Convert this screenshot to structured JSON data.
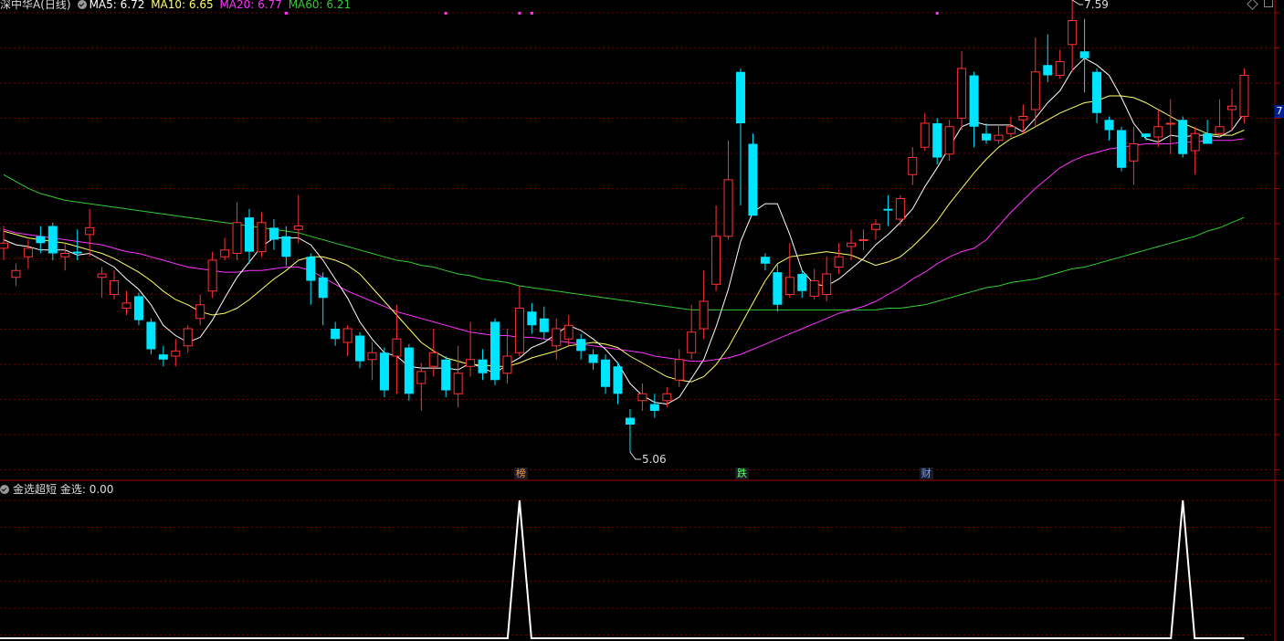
{
  "header": {
    "title": "深中华A(日线)",
    "ma5_label": "MA5: 6.72",
    "ma10_label": "MA10: 6.65",
    "ma20_label": "MA20: 6.77",
    "ma60_label": "MA60: 6.21"
  },
  "indicator": {
    "name": "金选超短",
    "value_label": "金选: 0.00"
  },
  "right_axis_label": "7",
  "events": [
    {
      "label": "榜",
      "bar": 42,
      "color": "#ff9933"
    },
    {
      "label": "跌",
      "bar": 60,
      "color": "#66ff66"
    },
    {
      "label": "财",
      "bar": 75,
      "color": "#66aaff"
    }
  ],
  "colors": {
    "up": "#ff3333",
    "down": "#00e5ff",
    "ma5": "#ffffff",
    "ma10": "#ffff66",
    "ma20": "#ff33ff",
    "ma60": "#33cc33",
    "grid": "#7a0000",
    "divider": "#a00000"
  },
  "chart_data": {
    "type": "candlestick",
    "y_range": [
      4.9,
      7.7
    ],
    "high_annotation": "7.59",
    "low_annotation": "5.06",
    "candles": [
      [
        6.25,
        6.28,
        6.38,
        6.18
      ],
      [
        6.08,
        6.12,
        6.16,
        6.03
      ],
      [
        6.2,
        6.25,
        6.3,
        6.13
      ],
      [
        6.32,
        6.28,
        6.38,
        6.22
      ],
      [
        6.38,
        6.22,
        6.4,
        6.18
      ],
      [
        6.2,
        6.22,
        6.28,
        6.12
      ],
      [
        6.23,
        6.22,
        6.36,
        6.18
      ],
      [
        6.33,
        6.37,
        6.48,
        6.2
      ],
      [
        6.08,
        6.1,
        6.14,
        5.96
      ],
      [
        5.98,
        6.06,
        6.12,
        5.95
      ],
      [
        5.9,
        5.93,
        6.0,
        5.86
      ],
      [
        5.97,
        5.83,
        5.99,
        5.8
      ],
      [
        5.82,
        5.66,
        5.84,
        5.63
      ],
      [
        5.63,
        5.6,
        5.68,
        5.56
      ],
      [
        5.62,
        5.65,
        5.72,
        5.56
      ],
      [
        5.68,
        5.78,
        5.8,
        5.64
      ],
      [
        5.84,
        5.92,
        5.98,
        5.8
      ],
      [
        6.0,
        6.18,
        6.23,
        5.96
      ],
      [
        6.2,
        6.24,
        6.31,
        6.18
      ],
      [
        6.22,
        6.4,
        6.52,
        6.18
      ],
      [
        6.43,
        6.23,
        6.48,
        6.16
      ],
      [
        6.23,
        6.4,
        6.46,
        6.2
      ],
      [
        6.37,
        6.3,
        6.42,
        6.24
      ],
      [
        6.32,
        6.2,
        6.38,
        6.15
      ],
      [
        6.36,
        6.38,
        6.56,
        6.28
      ],
      [
        6.2,
        6.06,
        6.22,
        5.92
      ],
      [
        6.08,
        5.96,
        6.11,
        5.8
      ],
      [
        5.78,
        5.72,
        5.82,
        5.68
      ],
      [
        5.7,
        5.78,
        5.8,
        5.62
      ],
      [
        5.74,
        5.59,
        5.76,
        5.55
      ],
      [
        5.6,
        5.64,
        5.7,
        5.48
      ],
      [
        5.64,
        5.42,
        5.67,
        5.38
      ],
      [
        5.62,
        5.72,
        5.92,
        5.4
      ],
      [
        5.67,
        5.4,
        5.69,
        5.36
      ],
      [
        5.46,
        5.53,
        5.58,
        5.3
      ],
      [
        5.56,
        5.64,
        5.78,
        5.5
      ],
      [
        5.6,
        5.42,
        5.62,
        5.38
      ],
      [
        5.4,
        5.52,
        5.68,
        5.32
      ],
      [
        5.56,
        5.6,
        5.82,
        5.5
      ],
      [
        5.6,
        5.52,
        5.66,
        5.48
      ],
      [
        5.82,
        5.48,
        5.84,
        5.45
      ],
      [
        5.52,
        5.62,
        5.78,
        5.46
      ],
      [
        5.64,
        5.9,
        6.03,
        5.62
      ],
      [
        5.88,
        5.8,
        5.93,
        5.75
      ],
      [
        5.84,
        5.76,
        5.91,
        5.72
      ],
      [
        5.68,
        5.78,
        5.84,
        5.6
      ],
      [
        5.72,
        5.8,
        5.86,
        5.68
      ],
      [
        5.72,
        5.65,
        5.75,
        5.6
      ],
      [
        5.63,
        5.58,
        5.66,
        5.54
      ],
      [
        5.6,
        5.44,
        5.63,
        5.4
      ],
      [
        5.56,
        5.4,
        5.58,
        5.34
      ],
      [
        5.26,
        5.22,
        5.31,
        5.06
      ],
      [
        5.36,
        5.4,
        5.46,
        5.3
      ],
      [
        5.34,
        5.3,
        5.4,
        5.26
      ],
      [
        5.36,
        5.4,
        5.44,
        5.32
      ],
      [
        5.48,
        5.6,
        5.66,
        5.44
      ],
      [
        5.64,
        5.76,
        5.92,
        5.6
      ],
      [
        5.78,
        5.94,
        6.12,
        5.72
      ],
      [
        6.04,
        6.32,
        6.5,
        6.0
      ],
      [
        6.32,
        6.65,
        6.88,
        6.3
      ],
      [
        7.28,
        6.98,
        7.3,
        6.5
      ],
      [
        6.86,
        6.44,
        6.92,
        6.44
      ],
      [
        6.2,
        6.16,
        6.22,
        6.12
      ],
      [
        6.11,
        5.92,
        6.16,
        5.88
      ],
      [
        5.98,
        6.08,
        6.28,
        5.96
      ],
      [
        6.1,
        6.0,
        6.12,
        5.96
      ],
      [
        5.97,
        6.06,
        6.13,
        5.95
      ],
      [
        5.98,
        6.1,
        6.2,
        5.94
      ],
      [
        6.14,
        6.2,
        6.28,
        6.1
      ],
      [
        6.26,
        6.28,
        6.36,
        6.18
      ],
      [
        6.3,
        6.3,
        6.36,
        6.24
      ],
      [
        6.36,
        6.39,
        6.42,
        6.3
      ],
      [
        6.48,
        6.47,
        6.56,
        6.38
      ],
      [
        6.42,
        6.54,
        6.56,
        6.38
      ],
      [
        6.68,
        6.78,
        6.84,
        6.62
      ],
      [
        6.84,
        6.98,
        7.04,
        6.82
      ],
      [
        6.98,
        6.78,
        7.01,
        6.74
      ],
      [
        6.8,
        6.96,
        7.0,
        6.76
      ],
      [
        7.01,
        7.3,
        7.4,
        6.94
      ],
      [
        7.26,
        6.96,
        7.28,
        6.84
      ],
      [
        6.92,
        6.88,
        6.98,
        6.86
      ],
      [
        6.88,
        6.91,
        6.97,
        6.86
      ],
      [
        6.92,
        6.96,
        7.02,
        6.9
      ],
      [
        7.0,
        7.02,
        7.09,
        6.92
      ],
      [
        7.06,
        7.28,
        7.48,
        6.96
      ],
      [
        7.32,
        7.26,
        7.5,
        7.22
      ],
      [
        7.26,
        7.34,
        7.41,
        7.24
      ],
      [
        7.44,
        7.58,
        7.7,
        7.28
      ],
      [
        7.4,
        7.36,
        7.59,
        7.16
      ],
      [
        7.28,
        7.04,
        7.3,
        6.98
      ],
      [
        7.0,
        6.94,
        7.02,
        6.88
      ],
      [
        6.94,
        6.72,
        6.96,
        6.7
      ],
      [
        6.76,
        6.86,
        6.96,
        6.62
      ],
      [
        6.92,
        6.9,
        6.92,
        6.88
      ],
      [
        6.9,
        6.96,
        7.06,
        6.84
      ],
      [
        6.98,
        6.98,
        7.12,
        6.8
      ],
      [
        7.0,
        6.8,
        7.02,
        6.78
      ],
      [
        6.82,
        6.92,
        6.96,
        6.68
      ],
      [
        6.92,
        6.86,
        7.0,
        6.86
      ],
      [
        6.92,
        6.96,
        7.12,
        6.9
      ],
      [
        7.06,
        7.08,
        7.18,
        6.94
      ],
      [
        7.02,
        7.26,
        7.3,
        6.98
      ]
    ],
    "ma5": [
      6.3,
      6.27,
      6.26,
      6.24,
      6.24,
      6.24,
      6.21,
      6.22,
      6.18,
      6.14,
      6.07,
      6.01,
      5.92,
      5.8,
      5.74,
      5.7,
      5.73,
      5.83,
      5.96,
      6.08,
      6.17,
      6.26,
      6.31,
      6.31,
      6.31,
      6.27,
      6.18,
      6.07,
      5.96,
      5.82,
      5.72,
      5.64,
      5.62,
      5.56,
      5.55,
      5.55,
      5.55,
      5.54,
      5.58,
      5.55,
      5.52,
      5.57,
      5.61,
      5.67,
      5.7,
      5.75,
      5.8,
      5.77,
      5.72,
      5.66,
      5.58,
      5.46,
      5.39,
      5.35,
      5.34,
      5.38,
      5.49,
      5.6,
      5.79,
      6.01,
      6.29,
      6.46,
      6.51,
      6.51,
      6.33,
      6.12,
      6.04,
      6.03,
      6.07,
      6.13,
      6.19,
      6.27,
      6.33,
      6.4,
      6.48,
      6.61,
      6.72,
      6.84,
      6.96,
      6.99,
      6.97,
      6.97,
      6.97,
      6.93,
      7.01,
      7.1,
      7.17,
      7.29,
      7.36,
      7.32,
      7.26,
      7.13,
      6.98,
      6.89,
      6.87,
      6.91,
      6.9,
      6.91,
      6.91,
      6.9,
      6.94,
      7.04
    ],
    "ma10": [
      6.35,
      6.33,
      6.31,
      6.3,
      6.29,
      6.28,
      6.26,
      6.24,
      6.22,
      6.19,
      6.15,
      6.11,
      6.06,
      6.0,
      5.95,
      5.92,
      5.88,
      5.86,
      5.87,
      5.9,
      5.95,
      6.01,
      6.07,
      6.12,
      6.18,
      6.2,
      6.2,
      6.18,
      6.15,
      6.1,
      6.02,
      5.94,
      5.86,
      5.78,
      5.7,
      5.65,
      5.61,
      5.59,
      5.57,
      5.57,
      5.56,
      5.56,
      5.58,
      5.61,
      5.63,
      5.65,
      5.68,
      5.69,
      5.7,
      5.69,
      5.67,
      5.62,
      5.58,
      5.54,
      5.5,
      5.48,
      5.47,
      5.5,
      5.57,
      5.67,
      5.8,
      5.93,
      6.06,
      6.16,
      6.2,
      6.21,
      6.22,
      6.23,
      6.22,
      6.21,
      6.18,
      6.15,
      6.17,
      6.2,
      6.26,
      6.33,
      6.41,
      6.51,
      6.6,
      6.69,
      6.77,
      6.84,
      6.89,
      6.92,
      6.96,
      7.0,
      7.04,
      7.07,
      7.1,
      7.11,
      7.14,
      7.14,
      7.13,
      7.1,
      7.06,
      7.02,
      6.98,
      6.95,
      6.92,
      6.91,
      6.91,
      6.94
    ],
    "ma20": [
      6.36,
      6.34,
      6.33,
      6.32,
      6.31,
      6.3,
      6.29,
      6.28,
      6.27,
      6.25,
      6.23,
      6.22,
      6.2,
      6.18,
      6.16,
      6.14,
      6.13,
      6.12,
      6.11,
      6.11,
      6.12,
      6.12,
      6.13,
      6.14,
      6.14,
      6.12,
      6.08,
      6.04,
      6.0,
      5.97,
      5.94,
      5.91,
      5.88,
      5.86,
      5.84,
      5.82,
      5.8,
      5.78,
      5.76,
      5.75,
      5.74,
      5.74,
      5.73,
      5.73,
      5.72,
      5.71,
      5.7,
      5.69,
      5.68,
      5.67,
      5.66,
      5.65,
      5.64,
      5.62,
      5.61,
      5.6,
      5.59,
      5.59,
      5.6,
      5.61,
      5.63,
      5.66,
      5.69,
      5.72,
      5.75,
      5.78,
      5.81,
      5.84,
      5.87,
      5.89,
      5.91,
      5.94,
      5.98,
      6.02,
      6.07,
      6.11,
      6.16,
      6.2,
      6.23,
      6.25,
      6.3,
      6.38,
      6.46,
      6.53,
      6.6,
      6.66,
      6.72,
      6.76,
      6.79,
      6.81,
      6.83,
      6.84,
      6.85,
      6.86,
      6.86,
      6.86,
      6.87,
      6.87,
      6.88,
      6.88,
      6.88,
      6.89
    ],
    "ma60": [
      6.68,
      6.64,
      6.6,
      6.57,
      6.55,
      6.53,
      6.52,
      6.51,
      6.5,
      6.49,
      6.48,
      6.47,
      6.46,
      6.45,
      6.44,
      6.43,
      6.42,
      6.41,
      6.4,
      6.39,
      6.38,
      6.37,
      6.36,
      6.35,
      6.34,
      6.32,
      6.3,
      6.28,
      6.26,
      6.24,
      6.22,
      6.2,
      6.18,
      6.17,
      6.15,
      6.14,
      6.12,
      6.1,
      6.09,
      6.07,
      6.06,
      6.05,
      6.03,
      6.02,
      6.01,
      6.0,
      5.99,
      5.98,
      5.97,
      5.96,
      5.95,
      5.94,
      5.93,
      5.92,
      5.91,
      5.9,
      5.89,
      5.89,
      5.89,
      5.89,
      5.89,
      5.89,
      5.89,
      5.89,
      5.89,
      5.89,
      5.89,
      5.89,
      5.89,
      5.89,
      5.89,
      5.89,
      5.9,
      5.9,
      5.91,
      5.92,
      5.94,
      5.96,
      5.98,
      6.0,
      6.02,
      6.03,
      6.05,
      6.06,
      6.07,
      6.09,
      6.11,
      6.13,
      6.14,
      6.16,
      6.18,
      6.2,
      6.22,
      6.24,
      6.26,
      6.28,
      6.3,
      6.32,
      6.35,
      6.37,
      6.4,
      6.43
    ],
    "indicator_spikes": [
      42,
      96
    ],
    "markers_top": [
      23,
      36,
      42,
      43,
      76
    ]
  }
}
